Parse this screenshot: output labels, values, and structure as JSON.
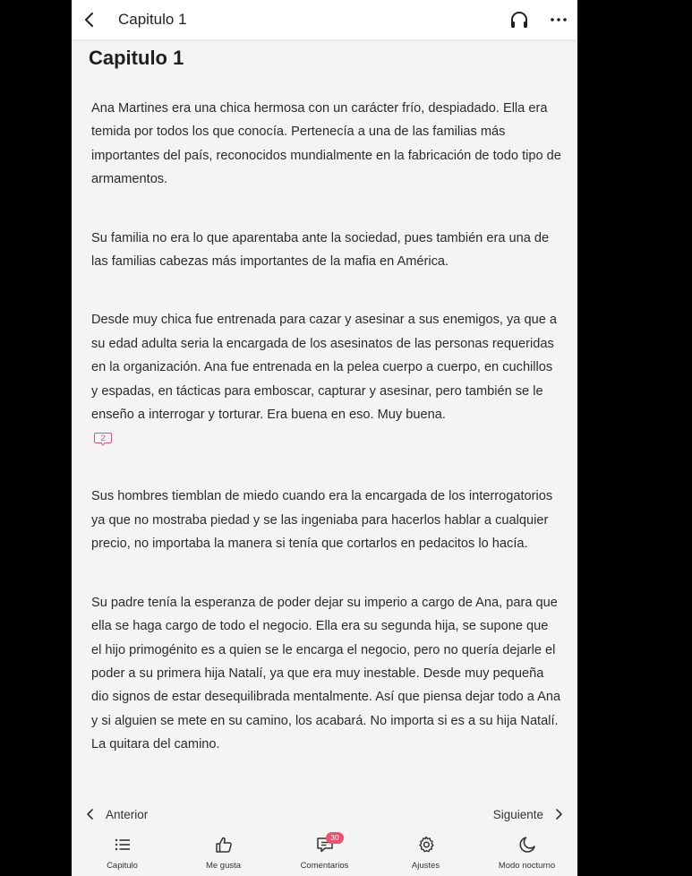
{
  "header": {
    "title": "Capitulo 1",
    "back_icon": "chevron-left-icon",
    "audio_icon": "headphones-icon",
    "more_icon": "more-horizontal-icon"
  },
  "chapter": {
    "heading": "Capitulo 1",
    "paragraphs": [
      "Ana Martines era una chica hermosa con un carácter frío, despiadado. Ella era temida por todos los que conocía. Pertenecía a una de las familias más importantes del país, reconocidos mundialmente en la fabricación de todo tipo de armamentos.",
      "Su familia no era lo que aparentaba ante la sociedad, pues también era una de las familias cabezas más importantes de la mafia en América.",
      "Desde muy chica fue entrenada para cazar y asesinar a sus enemigos, ya que a su edad adulta seria la encargada de los asesinatos de las personas requeridas en la organización. Ana fue entrenada en la pelea cuerpo a cuerpo, en cuchillos y espadas, en tácticas para emboscar, capturar y asesinar, pero también se le enseño a interrogar y torturar. Era buena en eso. Muy buena.",
      "Sus hombres tiemblan de miedo cuando era la encargada de los interrogatorios ya que no mostraba piedad y se las ingeniaba para hacerlos hablar a cualquier precio, no importaba la manera si tenía que cortarlos en pedacitos lo hacía.",
      "Su padre tenía la esperanza de poder dejar su imperio a cargo de Ana, para que ella se haga cargo de todo el negocio. Ella era su segunda hija, se supone que el hijo primogénito es a quien se le encarga el negocio, pero no quería dejarle el poder a su primera hija Natalí, ya que era muy inestable. Desde muy pequeña dio signos de estar desequilibrada mentalmente. Así que piensa dejar todo a Ana y si alguien se mete en su camino, los acabará. No importa si es a su hija Natalí. La quitara del camino."
    ],
    "paragraph_comment_count": "2",
    "comment_color": "#e5537a"
  },
  "navigation": {
    "prev_label": "Anterior",
    "next_label": "Siguiente"
  },
  "bottom_bar": {
    "tabs": [
      {
        "label": "Capitulo",
        "icon": "list-icon"
      },
      {
        "label": "Me gusta",
        "icon": "thumbs-up-icon"
      },
      {
        "label": "Comentarios",
        "icon": "comment-icon"
      },
      {
        "label": "Ajustes",
        "icon": "gear-icon"
      },
      {
        "label": "Modo nocturno",
        "icon": "moon-icon"
      }
    ],
    "comments_badge": "30",
    "badge_color": "#f0506e"
  }
}
